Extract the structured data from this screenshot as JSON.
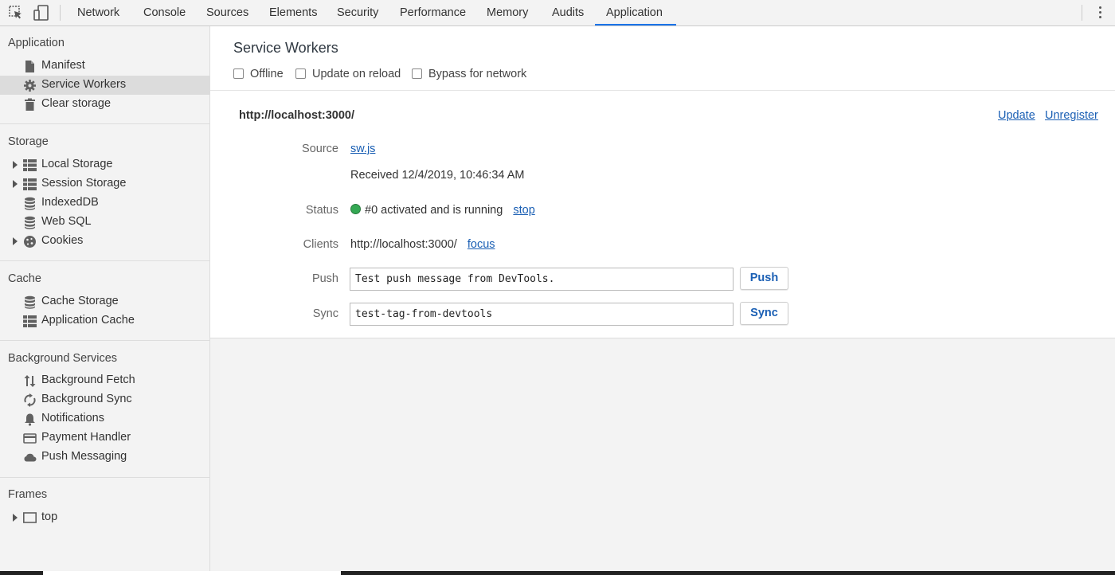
{
  "toolbar": {
    "tabs": [
      {
        "label": "Network"
      },
      {
        "label": "Console"
      },
      {
        "label": "Sources"
      },
      {
        "label": "Elements"
      },
      {
        "label": "Security"
      },
      {
        "label": "Performance"
      },
      {
        "label": "Memory"
      },
      {
        "label": "Audits"
      },
      {
        "label": "Application"
      }
    ],
    "active_tab": "Application",
    "accent_color": "#1a73e8",
    "icons": [
      "inspect-element-icon",
      "device-toolbar-icon",
      "more-options-icon"
    ]
  },
  "sidebar": {
    "sections": [
      {
        "title": "Application",
        "items": [
          {
            "label": "Manifest",
            "icon": "file-icon"
          },
          {
            "label": "Service Workers",
            "icon": "gear-icon",
            "selected": true
          },
          {
            "label": "Clear storage",
            "icon": "trash-icon"
          }
        ]
      },
      {
        "title": "Storage",
        "items": [
          {
            "label": "Local Storage",
            "icon": "grid-icon",
            "expandable": true
          },
          {
            "label": "Session Storage",
            "icon": "grid-icon",
            "expandable": true
          },
          {
            "label": "IndexedDB",
            "icon": "database-icon"
          },
          {
            "label": "Web SQL",
            "icon": "database-icon"
          },
          {
            "label": "Cookies",
            "icon": "cookie-icon",
            "expandable": true
          }
        ]
      },
      {
        "title": "Cache",
        "items": [
          {
            "label": "Cache Storage",
            "icon": "database-icon"
          },
          {
            "label": "Application Cache",
            "icon": "grid-icon"
          }
        ]
      },
      {
        "title": "Background Services",
        "items": [
          {
            "label": "Background Fetch",
            "icon": "up-down-arrows-icon"
          },
          {
            "label": "Background Sync",
            "icon": "sync-icon"
          },
          {
            "label": "Notifications",
            "icon": "bell-icon"
          },
          {
            "label": "Payment Handler",
            "icon": "credit-card-icon"
          },
          {
            "label": "Push Messaging",
            "icon": "cloud-icon"
          }
        ]
      },
      {
        "title": "Frames",
        "items": [
          {
            "label": "top",
            "icon": "frame-icon",
            "expandable": true
          }
        ]
      }
    ]
  },
  "main": {
    "title": "Service Workers",
    "options": [
      {
        "label": "Offline",
        "checked": false
      },
      {
        "label": "Update on reload",
        "checked": false
      },
      {
        "label": "Bypass for network",
        "checked": false
      }
    ],
    "worker": {
      "origin": "http://localhost:3000/",
      "update_link": "Update",
      "unregister_link": "Unregister",
      "source_label": "Source",
      "source_link": "sw.js",
      "received": "Received 12/4/2019, 10:46:34 AM",
      "status_label": "Status",
      "status_text": "#0 activated and is running",
      "status_color": "#34a853",
      "stop_link": "stop",
      "clients_label": "Clients",
      "clients_value": "http://localhost:3000/",
      "focus_link": "focus",
      "push_label": "Push",
      "push_value": "Test push message from DevTools.",
      "push_button": "Push",
      "sync_label": "Sync",
      "sync_value": "test-tag-from-devtools",
      "sync_button": "Sync"
    }
  }
}
